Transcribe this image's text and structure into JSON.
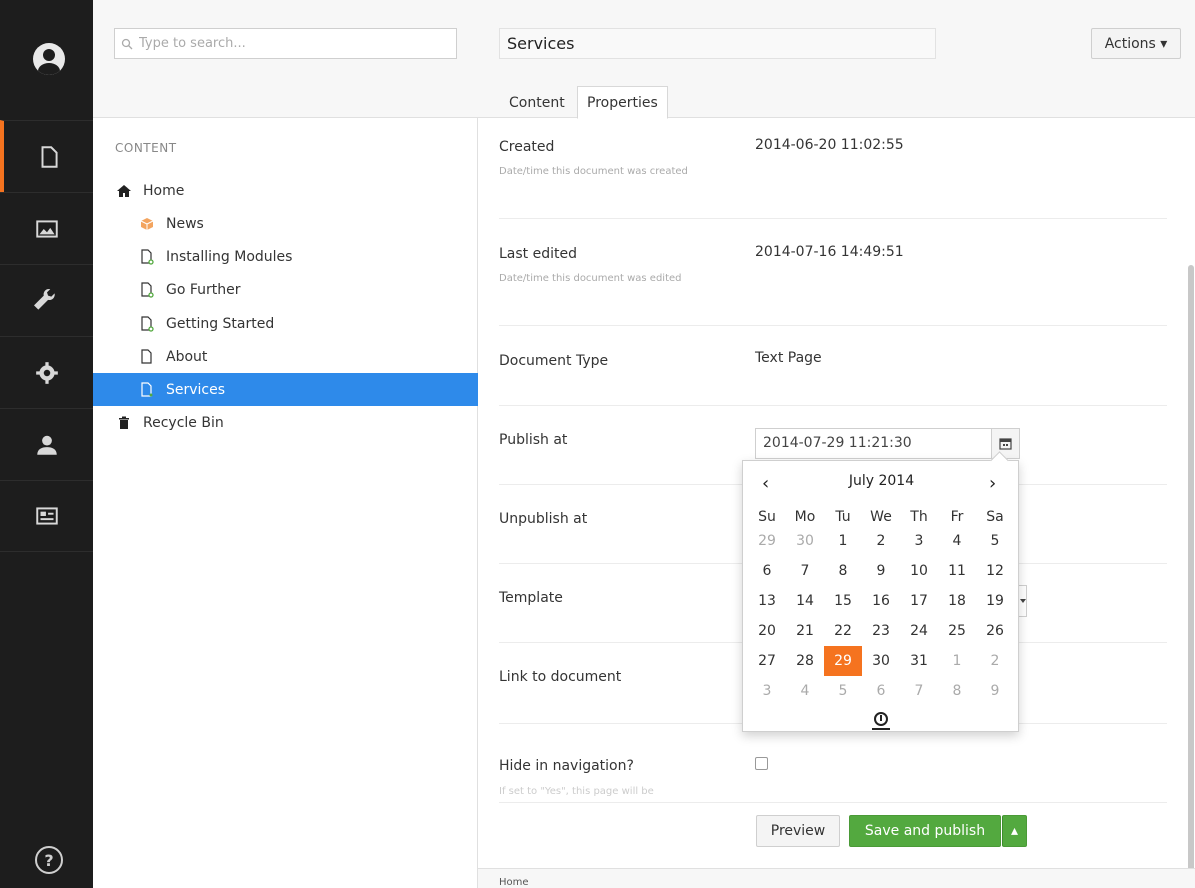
{
  "search": {
    "placeholder": "Type to search..."
  },
  "tree": {
    "section_label": "CONTENT",
    "items": [
      {
        "label": "Home",
        "icon": "home-icon"
      },
      {
        "label": "News",
        "icon": "box-icon"
      },
      {
        "label": "Installing Modules",
        "icon": "document-icon"
      },
      {
        "label": "Go Further",
        "icon": "document-icon"
      },
      {
        "label": "Getting Started",
        "icon": "document-icon"
      },
      {
        "label": "About",
        "icon": "document-icon"
      },
      {
        "label": "Services",
        "icon": "document-icon"
      },
      {
        "label": "Recycle Bin",
        "icon": "trash-icon"
      }
    ]
  },
  "editor": {
    "name": "Services",
    "actions_label": "Actions ▾",
    "tabs": [
      "Content",
      "Properties"
    ],
    "properties": {
      "created": {
        "label": "Created",
        "desc": "Date/time this document was created",
        "value": "2014-06-20 11:02:55"
      },
      "edited": {
        "label": "Last edited",
        "desc": "Date/time this document was edited",
        "value": "2014-07-16 14:49:51"
      },
      "doctype": {
        "label": "Document Type",
        "value": "Text Page"
      },
      "publish": {
        "label": "Publish at",
        "value": "2014-07-29 11:21:30"
      },
      "unpublish": {
        "label": "Unpublish at"
      },
      "template": {
        "label": "Template"
      },
      "link": {
        "label": "Link to document"
      },
      "hide": {
        "label": "Hide in navigation?",
        "desc": "If set to \"Yes\", this page will be"
      }
    },
    "buttons": {
      "preview": "Preview",
      "save": "Save and publish",
      "caret": "▴"
    },
    "breadcrumb": "Home"
  },
  "datepicker": {
    "month": "July 2014",
    "prev": "‹",
    "next": "›",
    "dow": [
      "Su",
      "Mo",
      "Tu",
      "We",
      "Th",
      "Fr",
      "Sa"
    ],
    "weeks": [
      [
        "29",
        "30",
        "1",
        "2",
        "3",
        "4",
        "5"
      ],
      [
        "6",
        "7",
        "8",
        "9",
        "10",
        "11",
        "12"
      ],
      [
        "13",
        "14",
        "15",
        "16",
        "17",
        "18",
        "19"
      ],
      [
        "20",
        "21",
        "22",
        "23",
        "24",
        "25",
        "26"
      ],
      [
        "27",
        "28",
        "29",
        "30",
        "31",
        "1",
        "2"
      ],
      [
        "3",
        "4",
        "5",
        "6",
        "7",
        "8",
        "9"
      ]
    ],
    "selected": "29",
    "highlight_color": "#f5731f"
  },
  "colors": {
    "accent": "#2e8aea",
    "active_section": "#f5731f",
    "save_green": "#53a93f"
  }
}
